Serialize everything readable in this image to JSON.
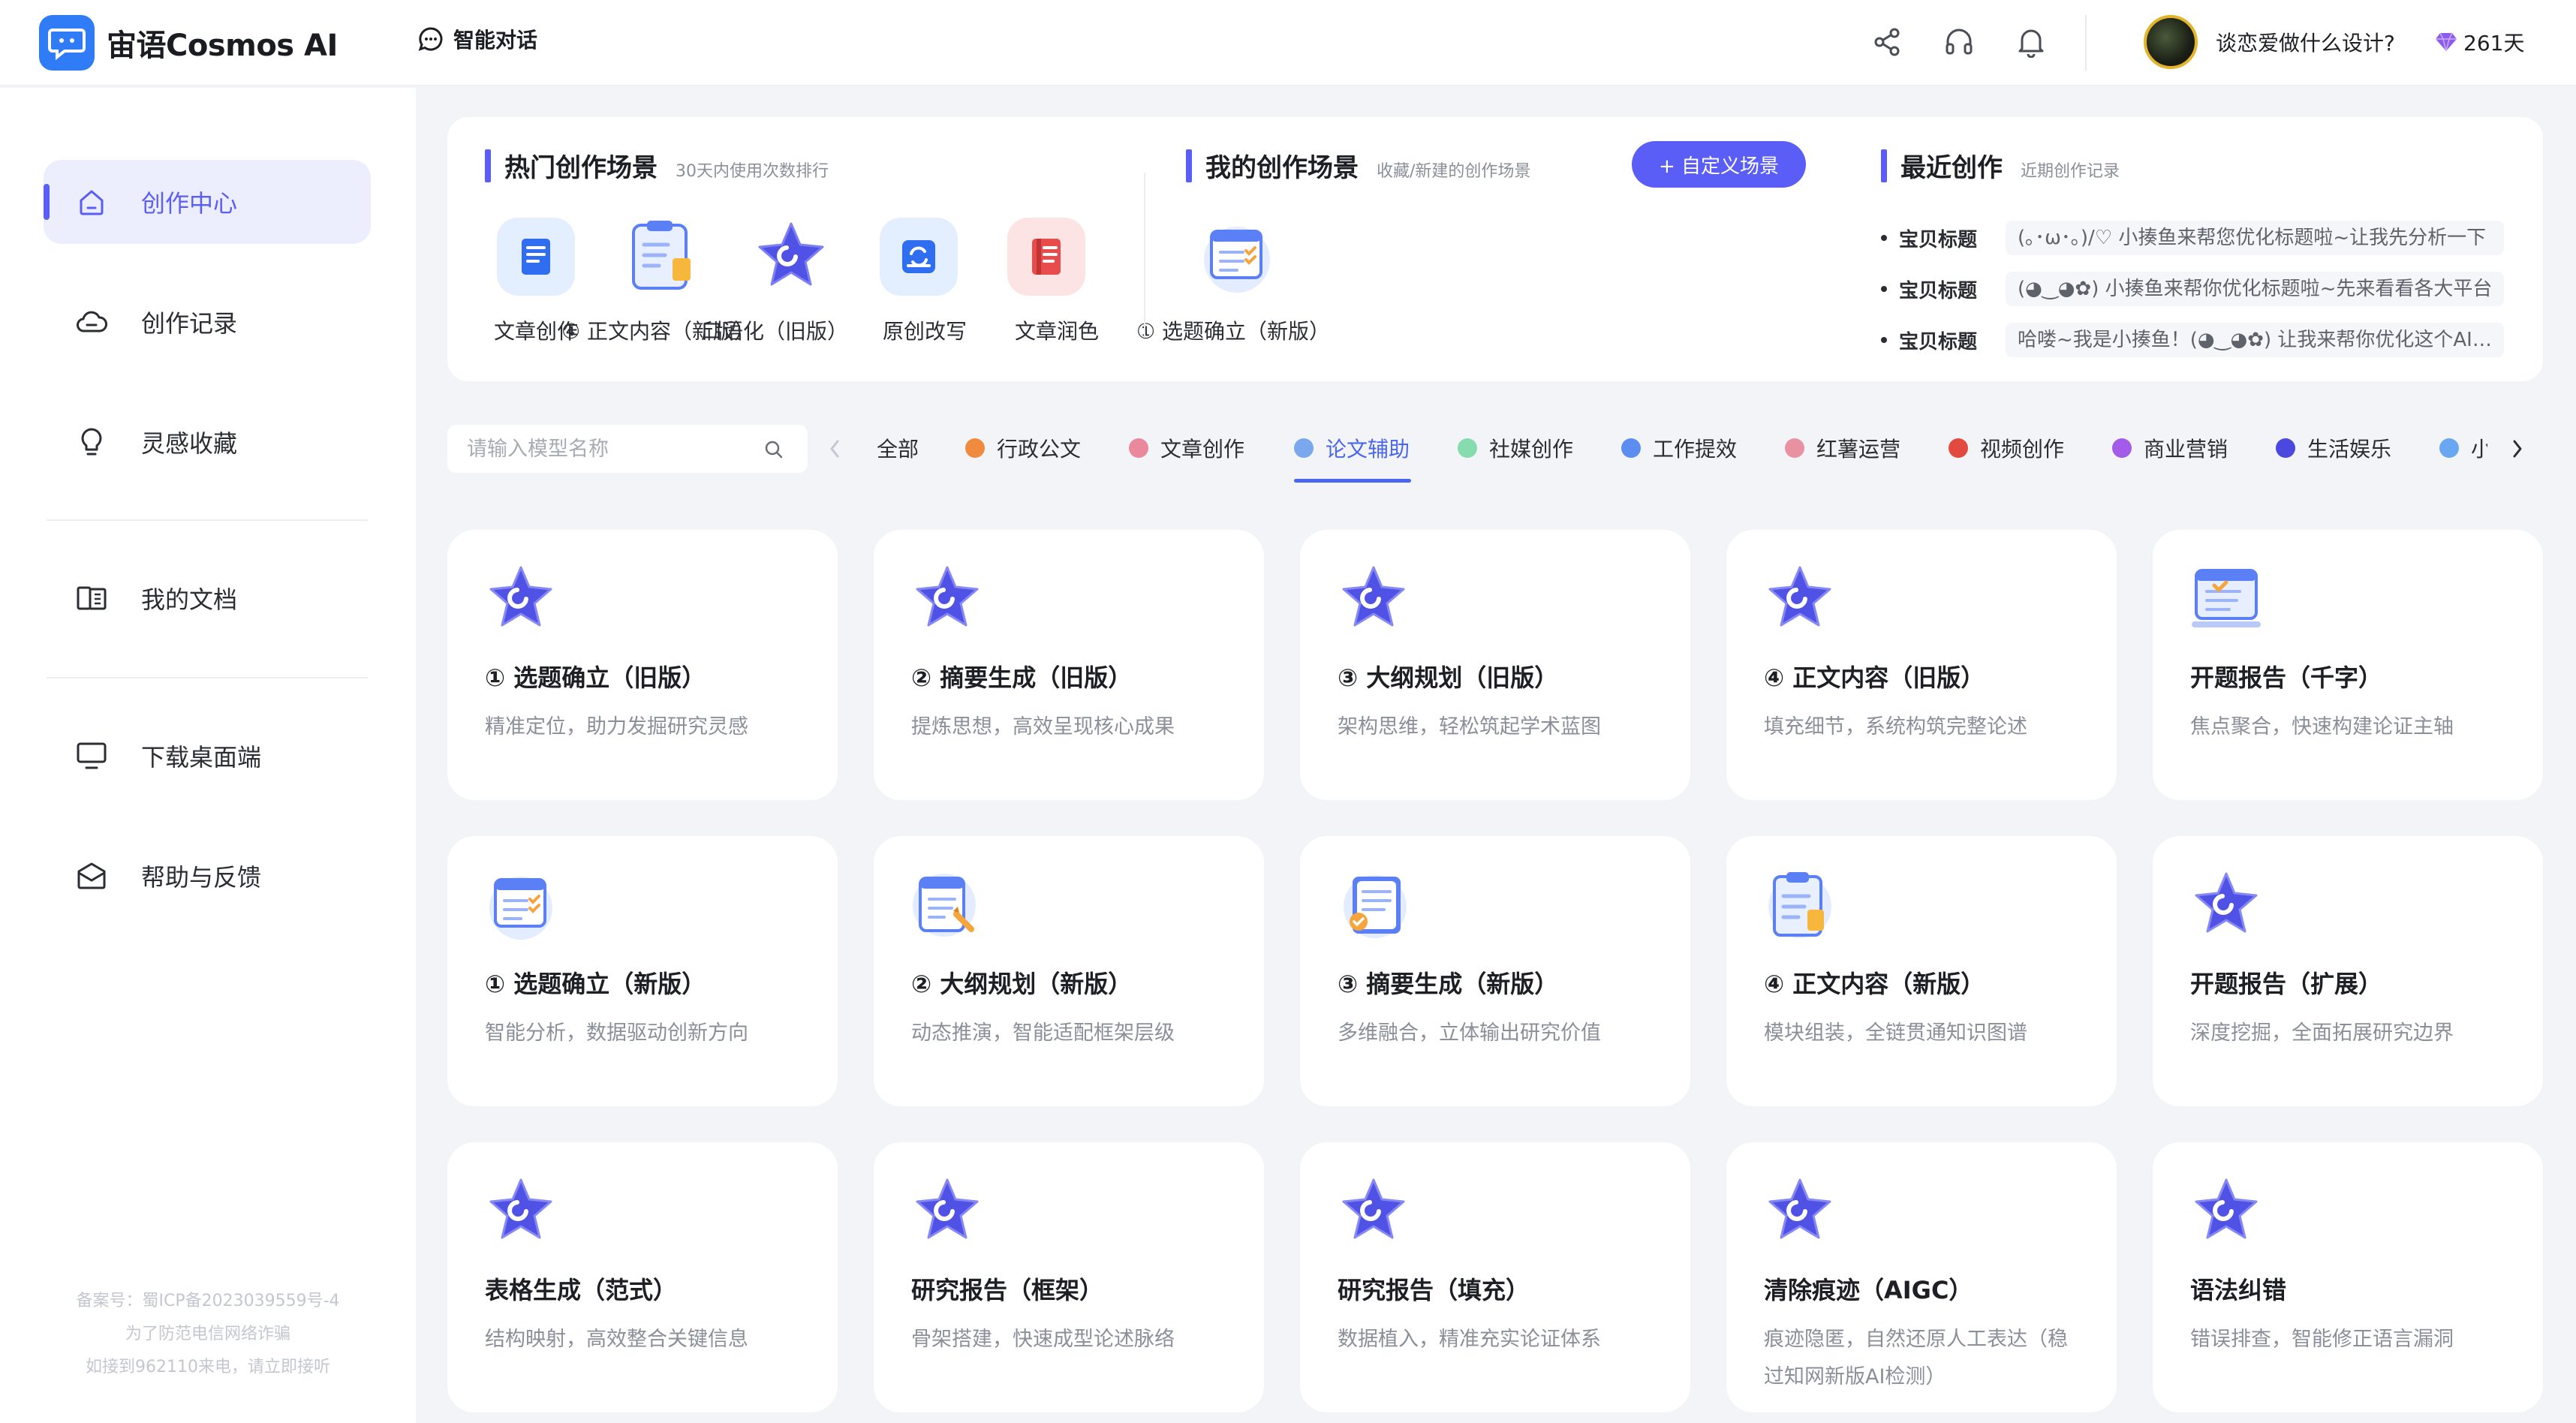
{
  "app": {
    "name": "宙语Cosmos AI",
    "mode_label": "智能对话",
    "user_name": "谈恋爱做什么设计?",
    "days_label": "261天"
  },
  "colors": {
    "accent": "#5b5ef6",
    "active_tab": "#4a66f0",
    "logo": "#2f7cf6"
  },
  "sidebar": {
    "items": [
      {
        "label": "创作中心",
        "icon": "home-icon",
        "active": true
      },
      {
        "label": "创作记录",
        "icon": "cloud-icon",
        "active": false
      },
      {
        "label": "灵感收藏",
        "icon": "bulb-icon",
        "active": false
      },
      {
        "label": "我的文档",
        "icon": "docs-icon",
        "active": false
      },
      {
        "label": "下载桌面端",
        "icon": "monitor-icon",
        "active": false
      },
      {
        "label": "帮助与反馈",
        "icon": "mail-icon",
        "active": false
      }
    ],
    "footer": [
      "备案号：蜀ICP备2023039559号-4",
      "为了防范电信网络诈骗",
      "如接到962110来电，请立即接听"
    ]
  },
  "hot": {
    "title": "热门创作场景",
    "subtitle": "30天内使用次数排行",
    "items": [
      {
        "label": "文章创作",
        "icon": "doc-book-icon"
      },
      {
        "label": "④ 正文内容（新版）",
        "icon": "clipboard-icon"
      },
      {
        "label": "口语化（旧版）",
        "icon": "star-icon"
      },
      {
        "label": "原创改写",
        "icon": "refresh-doc-icon"
      },
      {
        "label": "文章润色",
        "icon": "red-book-icon"
      }
    ]
  },
  "mine": {
    "title": "我的创作场景",
    "subtitle": "收藏/新建的创作场景",
    "add_button": "+ 自定义场景",
    "items": [
      {
        "label": "① 选题确立（新版）",
        "icon": "checklist-icon"
      }
    ]
  },
  "recent": {
    "title": "最近创作",
    "subtitle": "近期创作记录",
    "items": [
      {
        "key": "宝贝标题",
        "value": "(｡･ω･｡)/♡ 小揍鱼来帮您优化标题啦~让我先分析一下"
      },
      {
        "key": "宝贝标题",
        "value": "(◕‿◕✿) 小揍鱼来帮你优化标题啦~先来看看各大平台"
      },
      {
        "key": "宝贝标题",
        "value": "哈喽~我是小揍鱼！(◕‿◕✿) 让我来帮你优化这个AI标题"
      }
    ]
  },
  "search": {
    "placeholder": "请输入模型名称"
  },
  "categories": [
    {
      "label": "全部",
      "color": null,
      "active": false
    },
    {
      "label": "行政公文",
      "color": "#ef8a3e",
      "active": false
    },
    {
      "label": "文章创作",
      "color": "#e9899b",
      "active": false
    },
    {
      "label": "论文辅助",
      "color": "#7aa8ee",
      "active": true
    },
    {
      "label": "社媒创作",
      "color": "#86dcae",
      "active": false
    },
    {
      "label": "工作提效",
      "color": "#5b8ef0",
      "active": false
    },
    {
      "label": "红薯运营",
      "color": "#e991a0",
      "active": false
    },
    {
      "label": "视频创作",
      "color": "#e34a3f",
      "active": false
    },
    {
      "label": "商业营销",
      "color": "#a45be8",
      "active": false
    },
    {
      "label": "生活娱乐",
      "color": "#4b48e0",
      "active": false
    },
    {
      "label": "小说创作",
      "color": "#6aa7f3",
      "active": false
    }
  ],
  "cards": [
    {
      "title": "① 选题确立（旧版）",
      "desc": "精准定位，助力发掘研究灵感",
      "icon": "star-icon"
    },
    {
      "title": "② 摘要生成（旧版）",
      "desc": "提炼思想，高效呈现核心成果",
      "icon": "star-icon"
    },
    {
      "title": "③ 大纲规划（旧版）",
      "desc": "架构思维，轻松筑起学术蓝图",
      "icon": "star-icon"
    },
    {
      "title": "④ 正文内容（旧版）",
      "desc": "填充细节，系统构筑完整论述",
      "icon": "star-icon"
    },
    {
      "title": "开题报告（千字）",
      "desc": "焦点聚合，快速构建论证主轴",
      "icon": "laptop-doc-icon"
    },
    {
      "title": "① 选题确立（新版）",
      "desc": "智能分析，数据驱动创新方向",
      "icon": "checklist-icon"
    },
    {
      "title": "② 大纲规划（新版）",
      "desc": "动态推演，智能适配框架层级",
      "icon": "pencil-doc-icon"
    },
    {
      "title": "③ 摘要生成（新版）",
      "desc": "多维融合，立体输出研究价值",
      "icon": "badge-doc-icon"
    },
    {
      "title": "④ 正文内容（新版）",
      "desc": "模块组装，全链贯通知识图谱",
      "icon": "clipboard-icon"
    },
    {
      "title": "开题报告（扩展）",
      "desc": "深度挖掘，全面拓展研究边界",
      "icon": "star-icon"
    },
    {
      "title": "表格生成（范式）",
      "desc": "结构映射，高效整合关键信息",
      "icon": "star-icon"
    },
    {
      "title": "研究报告（框架）",
      "desc": "骨架搭建，快速成型论述脉络",
      "icon": "star-icon"
    },
    {
      "title": "研究报告（填充）",
      "desc": "数据植入，精准充实论证体系",
      "icon": "star-icon"
    },
    {
      "title": "清除痕迹（AIGC）",
      "desc": "痕迹隐匿，自然还原人工表达（稳过知网新版AI检测）",
      "icon": "star-icon"
    },
    {
      "title": "语法纠错",
      "desc": "错误排查，智能修正语言漏洞",
      "icon": "star-icon"
    }
  ]
}
